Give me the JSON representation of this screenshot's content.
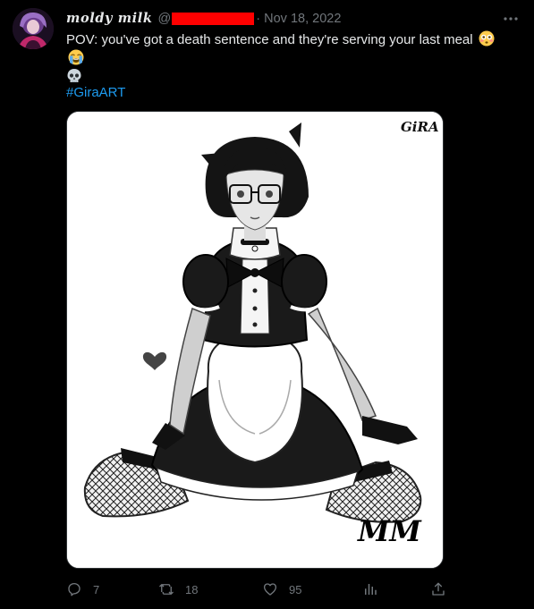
{
  "tweet": {
    "display_name": "moldy milk",
    "handle_prefix": "@",
    "separator": "·",
    "date": "Nov 18, 2022",
    "text": "POV: you've got a death sentence and they're serving your last meal",
    "emojis": [
      "flushed-face",
      "loudly-crying-face",
      "skull"
    ],
    "hashtag": "#GiraART",
    "media": {
      "signature_top": "GiRA",
      "signature_bottom": "MM"
    },
    "actions": {
      "reply": "7",
      "retweet": "18",
      "like": "95",
      "views": "",
      "share": ""
    }
  },
  "colors": {
    "background": "#000000",
    "text": "#e7e9ea",
    "muted": "#71767b",
    "link": "#1d9bf0",
    "redaction": "#ff0000"
  },
  "icons": [
    "more-icon",
    "reply-icon",
    "retweet-icon",
    "like-icon",
    "views-icon",
    "share-icon"
  ]
}
